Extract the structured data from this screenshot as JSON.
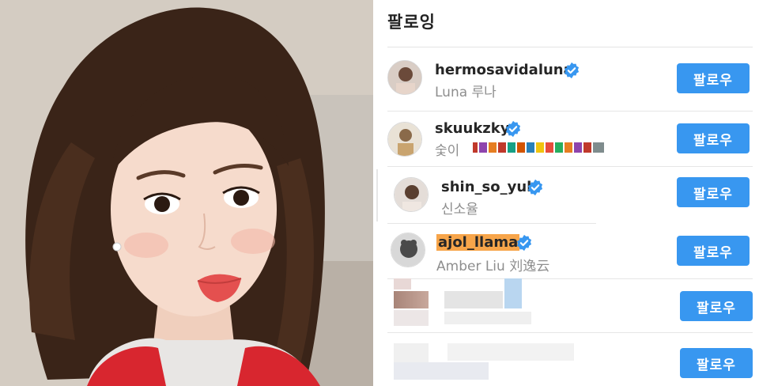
{
  "header": {
    "title": "팔로잉"
  },
  "following": [
    {
      "username": "hermosavidaluna",
      "display_name": "Luna 루나",
      "verified": true,
      "button": "팔로우",
      "highlighted": false
    },
    {
      "username": "skuukzky",
      "display_name": "숯이",
      "verified": true,
      "button": "팔로우",
      "highlighted": false
    },
    {
      "username": "shin_so_yul",
      "display_name": "신소율",
      "verified": true,
      "button": "팔로우",
      "highlighted": false
    },
    {
      "username": "ajol_llama",
      "display_name": "Amber Liu 刘逸云",
      "verified": true,
      "button": "팔로우",
      "highlighted": true
    },
    {
      "username": "",
      "display_name": "",
      "verified": false,
      "button": "팔로우",
      "blurred": true
    },
    {
      "username": "",
      "display_name": "",
      "verified": false,
      "button": "팔로우",
      "blurred": true
    }
  ],
  "colors": {
    "button": "#3897f0",
    "verified": "#3897f0",
    "highlight": "#f7a54a"
  }
}
